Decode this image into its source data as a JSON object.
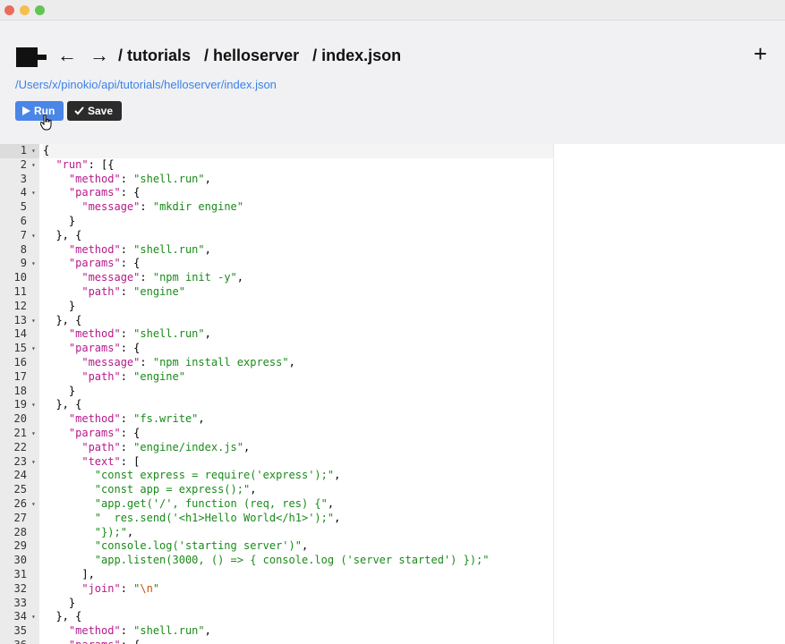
{
  "window": {
    "title": ""
  },
  "nav": {
    "back_icon": "←",
    "forward_icon": "→",
    "breadcrumbs": [
      "/ tutorials",
      "/ helloserver",
      "/ index.json"
    ],
    "new_icon": "+"
  },
  "file": {
    "path": "/Users/x/pinokio/api/tutorials/helloserver/index.json"
  },
  "toolbar": {
    "run_label": "Run",
    "save_label": "Save"
  },
  "colors": {
    "accent": "#4a86e8",
    "save_bg": "#2b2b2b",
    "link": "#3b82e6",
    "json_key": "#b5198a",
    "json_string": "#1a8a1a",
    "json_escape": "#c6520a"
  },
  "editor": {
    "lines": [
      {
        "n": "1",
        "fold": true,
        "tokens": [
          [
            "p",
            "{"
          ]
        ]
      },
      {
        "n": "2",
        "fold": true,
        "tokens": [
          [
            "p",
            "  "
          ],
          [
            "key",
            "\"run\""
          ],
          [
            "p",
            ": [{"
          ]
        ]
      },
      {
        "n": "3",
        "fold": false,
        "tokens": [
          [
            "p",
            "    "
          ],
          [
            "key",
            "\"method\""
          ],
          [
            "p",
            ": "
          ],
          [
            "str",
            "\"shell.run\""
          ],
          [
            "p",
            ","
          ]
        ]
      },
      {
        "n": "4",
        "fold": true,
        "tokens": [
          [
            "p",
            "    "
          ],
          [
            "key",
            "\"params\""
          ],
          [
            "p",
            ": {"
          ]
        ]
      },
      {
        "n": "5",
        "fold": false,
        "tokens": [
          [
            "p",
            "      "
          ],
          [
            "key",
            "\"message\""
          ],
          [
            "p",
            ": "
          ],
          [
            "str",
            "\"mkdir engine\""
          ]
        ]
      },
      {
        "n": "6",
        "fold": false,
        "tokens": [
          [
            "p",
            "    }"
          ]
        ]
      },
      {
        "n": "7",
        "fold": true,
        "tokens": [
          [
            "p",
            "  }, {"
          ]
        ]
      },
      {
        "n": "8",
        "fold": false,
        "tokens": [
          [
            "p",
            "    "
          ],
          [
            "key",
            "\"method\""
          ],
          [
            "p",
            ": "
          ],
          [
            "str",
            "\"shell.run\""
          ],
          [
            "p",
            ","
          ]
        ]
      },
      {
        "n": "9",
        "fold": true,
        "tokens": [
          [
            "p",
            "    "
          ],
          [
            "key",
            "\"params\""
          ],
          [
            "p",
            ": {"
          ]
        ]
      },
      {
        "n": "10",
        "fold": false,
        "tokens": [
          [
            "p",
            "      "
          ],
          [
            "key",
            "\"message\""
          ],
          [
            "p",
            ": "
          ],
          [
            "str",
            "\"npm init -y\""
          ],
          [
            "p",
            ","
          ]
        ]
      },
      {
        "n": "11",
        "fold": false,
        "tokens": [
          [
            "p",
            "      "
          ],
          [
            "key",
            "\"path\""
          ],
          [
            "p",
            ": "
          ],
          [
            "str",
            "\"engine\""
          ]
        ]
      },
      {
        "n": "12",
        "fold": false,
        "tokens": [
          [
            "p",
            "    }"
          ]
        ]
      },
      {
        "n": "13",
        "fold": true,
        "tokens": [
          [
            "p",
            "  }, {"
          ]
        ]
      },
      {
        "n": "14",
        "fold": false,
        "tokens": [
          [
            "p",
            "    "
          ],
          [
            "key",
            "\"method\""
          ],
          [
            "p",
            ": "
          ],
          [
            "str",
            "\"shell.run\""
          ],
          [
            "p",
            ","
          ]
        ]
      },
      {
        "n": "15",
        "fold": true,
        "tokens": [
          [
            "p",
            "    "
          ],
          [
            "key",
            "\"params\""
          ],
          [
            "p",
            ": {"
          ]
        ]
      },
      {
        "n": "16",
        "fold": false,
        "tokens": [
          [
            "p",
            "      "
          ],
          [
            "key",
            "\"message\""
          ],
          [
            "p",
            ": "
          ],
          [
            "str",
            "\"npm install express\""
          ],
          [
            "p",
            ","
          ]
        ]
      },
      {
        "n": "17",
        "fold": false,
        "tokens": [
          [
            "p",
            "      "
          ],
          [
            "key",
            "\"path\""
          ],
          [
            "p",
            ": "
          ],
          [
            "str",
            "\"engine\""
          ]
        ]
      },
      {
        "n": "18",
        "fold": false,
        "tokens": [
          [
            "p",
            "    }"
          ]
        ]
      },
      {
        "n": "19",
        "fold": true,
        "tokens": [
          [
            "p",
            "  }, {"
          ]
        ]
      },
      {
        "n": "20",
        "fold": false,
        "tokens": [
          [
            "p",
            "    "
          ],
          [
            "key",
            "\"method\""
          ],
          [
            "p",
            ": "
          ],
          [
            "str",
            "\"fs.write\""
          ],
          [
            "p",
            ","
          ]
        ]
      },
      {
        "n": "21",
        "fold": true,
        "tokens": [
          [
            "p",
            "    "
          ],
          [
            "key",
            "\"params\""
          ],
          [
            "p",
            ": {"
          ]
        ]
      },
      {
        "n": "22",
        "fold": false,
        "tokens": [
          [
            "p",
            "      "
          ],
          [
            "key",
            "\"path\""
          ],
          [
            "p",
            ": "
          ],
          [
            "str",
            "\"engine/index.js\""
          ],
          [
            "p",
            ","
          ]
        ]
      },
      {
        "n": "23",
        "fold": true,
        "tokens": [
          [
            "p",
            "      "
          ],
          [
            "key",
            "\"text\""
          ],
          [
            "p",
            ": ["
          ]
        ]
      },
      {
        "n": "24",
        "fold": false,
        "tokens": [
          [
            "p",
            "        "
          ],
          [
            "str",
            "\"const express = require('express');\""
          ],
          [
            "p",
            ","
          ]
        ]
      },
      {
        "n": "25",
        "fold": false,
        "tokens": [
          [
            "p",
            "        "
          ],
          [
            "str",
            "\"const app = express();\""
          ],
          [
            "p",
            ","
          ]
        ]
      },
      {
        "n": "26",
        "fold": true,
        "tokens": [
          [
            "p",
            "        "
          ],
          [
            "str",
            "\"app.get('/', function (req, res) {\""
          ],
          [
            "p",
            ","
          ]
        ]
      },
      {
        "n": "27",
        "fold": false,
        "tokens": [
          [
            "p",
            "        "
          ],
          [
            "str",
            "\"  res.send('<h1>Hello World</h1>');\""
          ],
          [
            "p",
            ","
          ]
        ]
      },
      {
        "n": "28",
        "fold": false,
        "tokens": [
          [
            "p",
            "        "
          ],
          [
            "str",
            "\"});\""
          ],
          [
            "p",
            ","
          ]
        ]
      },
      {
        "n": "29",
        "fold": false,
        "tokens": [
          [
            "p",
            "        "
          ],
          [
            "str",
            "\"console.log('starting server')\""
          ],
          [
            "p",
            ","
          ]
        ]
      },
      {
        "n": "30",
        "fold": false,
        "tokens": [
          [
            "p",
            "        "
          ],
          [
            "str",
            "\"app.listen(3000, () => { console.log ('server started') });\""
          ]
        ]
      },
      {
        "n": "31",
        "fold": false,
        "tokens": [
          [
            "p",
            "      ],"
          ]
        ]
      },
      {
        "n": "32",
        "fold": false,
        "tokens": [
          [
            "p",
            "      "
          ],
          [
            "key",
            "\"join\""
          ],
          [
            "p",
            ": "
          ],
          [
            "str",
            "\""
          ],
          [
            "esc",
            "\\n"
          ],
          [
            "str",
            "\""
          ]
        ]
      },
      {
        "n": "33",
        "fold": false,
        "tokens": [
          [
            "p",
            "    }"
          ]
        ]
      },
      {
        "n": "34",
        "fold": true,
        "tokens": [
          [
            "p",
            "  }, {"
          ]
        ]
      },
      {
        "n": "35",
        "fold": false,
        "tokens": [
          [
            "p",
            "    "
          ],
          [
            "key",
            "\"method\""
          ],
          [
            "p",
            ": "
          ],
          [
            "str",
            "\"shell.run\""
          ],
          [
            "p",
            ","
          ]
        ]
      },
      {
        "n": "36",
        "fold": true,
        "tokens": [
          [
            "p",
            "    "
          ],
          [
            "key",
            "\"params\""
          ],
          [
            "p",
            ": {"
          ]
        ]
      }
    ]
  }
}
